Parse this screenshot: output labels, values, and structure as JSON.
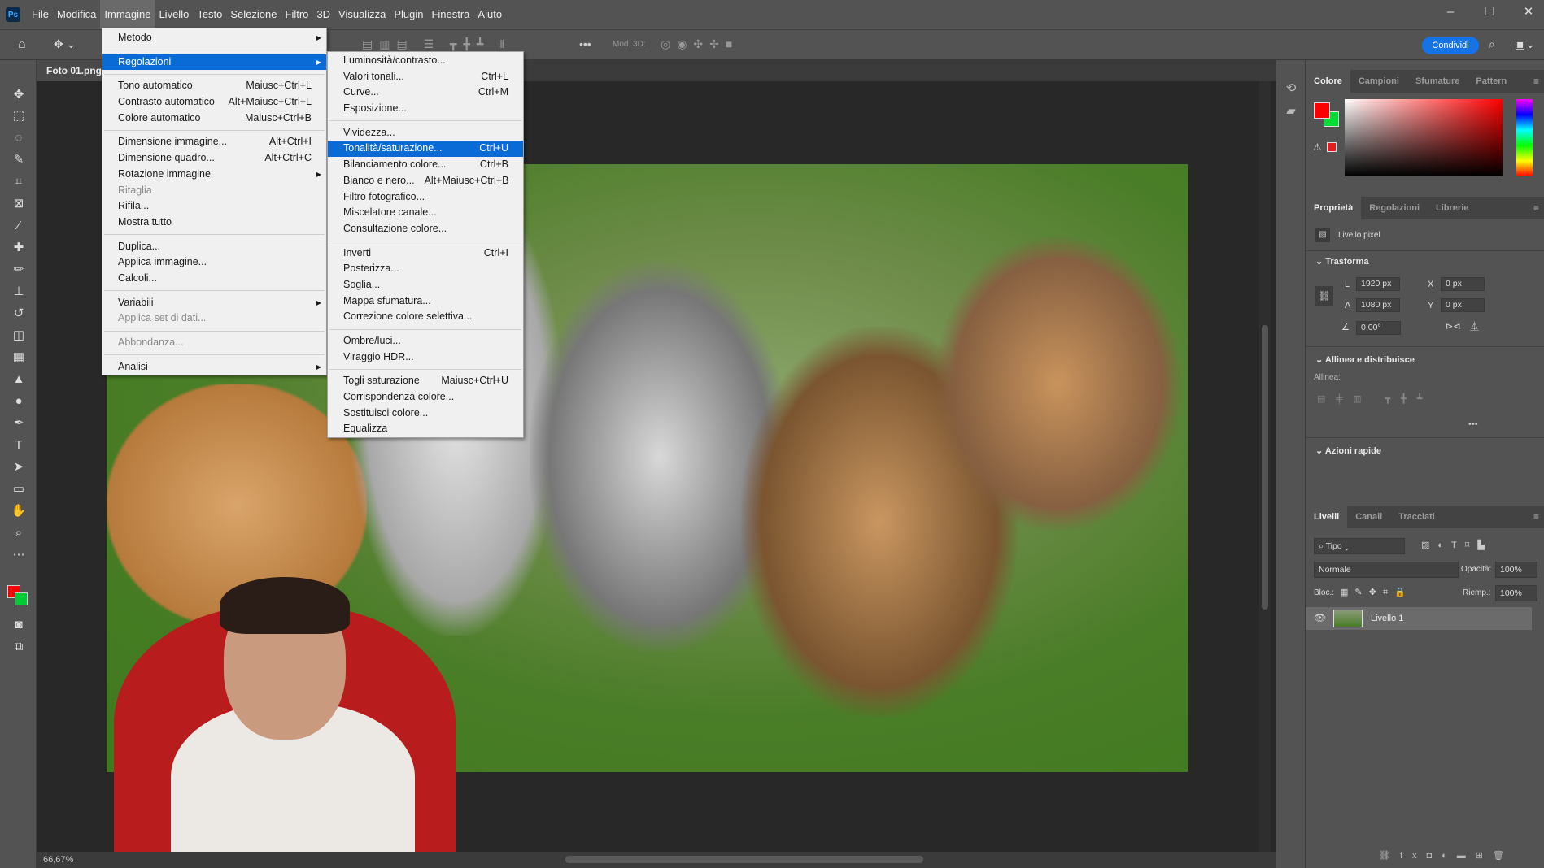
{
  "menubar": {
    "logo": "Ps",
    "items": [
      "File",
      "Modifica",
      "Immagine",
      "Livello",
      "Testo",
      "Selezione",
      "Filtro",
      "3D",
      "Visualizza",
      "Plugin",
      "Finestra",
      "Aiuto"
    ],
    "active": "Immagine"
  },
  "window_controls": {
    "minimize": "–",
    "maximize": "☐",
    "close": "✕"
  },
  "optbar": {
    "mode3d": "Mod. 3D:",
    "more": "•••",
    "share": "Condividi"
  },
  "document": {
    "tab": "Foto 01.png",
    "zoom": "66,67%"
  },
  "image_menu": [
    {
      "label": "Metodo",
      "sub": true
    },
    {
      "sep": true
    },
    {
      "label": "Regolazioni",
      "sub": true,
      "highlight": true
    },
    {
      "sep": true
    },
    {
      "label": "Tono automatico",
      "shortcut": "Maiusc+Ctrl+L"
    },
    {
      "label": "Contrasto automatico",
      "shortcut": "Alt+Maiusc+Ctrl+L"
    },
    {
      "label": "Colore automatico",
      "shortcut": "Maiusc+Ctrl+B"
    },
    {
      "sep": true
    },
    {
      "label": "Dimensione immagine...",
      "shortcut": "Alt+Ctrl+I"
    },
    {
      "label": "Dimensione quadro...",
      "shortcut": "Alt+Ctrl+C"
    },
    {
      "label": "Rotazione immagine",
      "sub": true
    },
    {
      "label": "Ritaglia",
      "disabled": true
    },
    {
      "label": "Rifila..."
    },
    {
      "label": "Mostra tutto"
    },
    {
      "sep": true
    },
    {
      "label": "Duplica..."
    },
    {
      "label": "Applica immagine..."
    },
    {
      "label": "Calcoli..."
    },
    {
      "sep": true
    },
    {
      "label": "Variabili",
      "sub": true
    },
    {
      "label": "Applica set di dati...",
      "disabled": true
    },
    {
      "sep": true
    },
    {
      "label": "Abbondanza...",
      "disabled": true
    },
    {
      "sep": true
    },
    {
      "label": "Analisi",
      "sub": true
    }
  ],
  "adjust_menu": [
    {
      "label": "Luminosità/contrasto..."
    },
    {
      "label": "Valori tonali...",
      "shortcut": "Ctrl+L"
    },
    {
      "label": "Curve...",
      "shortcut": "Ctrl+M"
    },
    {
      "label": "Esposizione..."
    },
    {
      "sep": true
    },
    {
      "label": "Vividezza..."
    },
    {
      "label": "Tonalità/saturazione...",
      "shortcut": "Ctrl+U",
      "highlight": true
    },
    {
      "label": "Bilanciamento colore...",
      "shortcut": "Ctrl+B"
    },
    {
      "label": "Bianco e nero...",
      "shortcut": "Alt+Maiusc+Ctrl+B"
    },
    {
      "label": "Filtro fotografico..."
    },
    {
      "label": "Miscelatore canale..."
    },
    {
      "label": "Consultazione colore..."
    },
    {
      "sep": true
    },
    {
      "label": "Inverti",
      "shortcut": "Ctrl+I"
    },
    {
      "label": "Posterizza..."
    },
    {
      "label": "Soglia..."
    },
    {
      "label": "Mappa sfumatura..."
    },
    {
      "label": "Correzione colore selettiva..."
    },
    {
      "sep": true
    },
    {
      "label": "Ombre/luci..."
    },
    {
      "label": "Viraggio HDR..."
    },
    {
      "sep": true
    },
    {
      "label": "Togli saturazione",
      "shortcut": "Maiusc+Ctrl+U"
    },
    {
      "label": "Corrispondenza colore..."
    },
    {
      "label": "Sostituisci colore..."
    },
    {
      "label": "Equalizza"
    }
  ],
  "color_panel": {
    "tabs": [
      "Colore",
      "Campioni",
      "Sfumature",
      "Pattern"
    ],
    "foreground": "#ff0000",
    "background": "#00cc33"
  },
  "properties_panel": {
    "tabs": [
      "Proprietà",
      "Regolazioni",
      "Librerie"
    ],
    "layer_type": "Livello pixel",
    "transform": {
      "title": "Trasforma",
      "L_label": "L",
      "L": "1920 px",
      "A_label": "A",
      "A": "1080 px",
      "X_label": "X",
      "X": "0 px",
      "Y_label": "Y",
      "Y": "0 px",
      "angle": "0,00°"
    },
    "align": {
      "title": "Allinea e distribuisce",
      "label": "Allinea:",
      "more": "•••"
    },
    "quick": {
      "title": "Azioni rapide"
    }
  },
  "layers_panel": {
    "tabs": [
      "Livelli",
      "Canali",
      "Tracciati"
    ],
    "filter": "Tipo",
    "blend": "Normale",
    "opacity_label": "Opacità:",
    "opacity": "100%",
    "lock_label": "Bloc.:",
    "fill_label": "Riemp.:",
    "fill": "100%",
    "layers": [
      {
        "name": "Livello 1",
        "visible": true
      }
    ]
  }
}
